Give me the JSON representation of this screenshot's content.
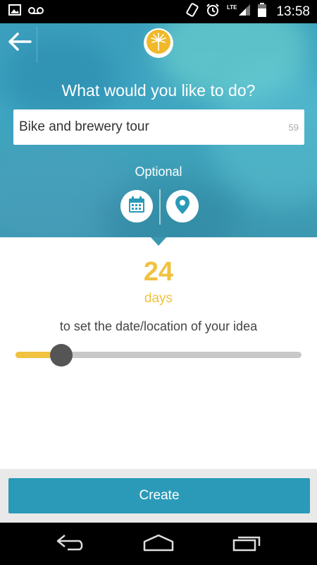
{
  "status_bar": {
    "time": "13:58",
    "network": "LTE",
    "left_icons": [
      "image-icon",
      "voicemail-icon"
    ],
    "right_icons": [
      "rotate-icon",
      "alarm-icon",
      "signal-icon",
      "battery-icon"
    ]
  },
  "header": {
    "question": "What would you like to do?",
    "idea_input": {
      "value": "Bike and brewery tour",
      "placeholder": ""
    },
    "char_counter": "59",
    "optional_label": "Optional",
    "optional_buttons": [
      "calendar-icon",
      "location-pin-icon"
    ]
  },
  "countdown": {
    "number": "24",
    "unit": "days",
    "description": "to set the date/location of your idea",
    "slider_fraction": 0.16
  },
  "actions": {
    "create_label": "Create"
  },
  "nav_bar": {
    "icons": [
      "back-nav-icon",
      "home-nav-icon",
      "recents-nav-icon"
    ]
  },
  "colors": {
    "accent_yellow": "#f0c240",
    "button_teal": "#2a9ab8",
    "slider_thumb": "#555555",
    "slider_track": "#c8c8c8"
  }
}
